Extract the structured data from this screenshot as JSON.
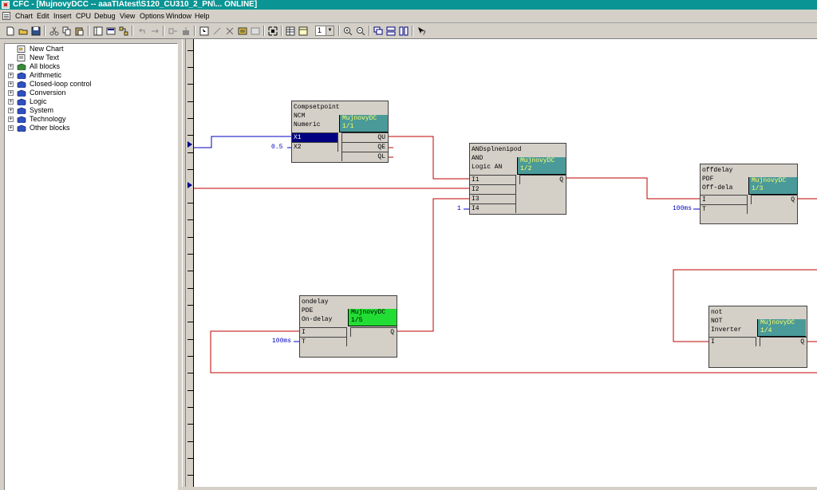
{
  "window": {
    "title": "CFC - [MujnovyDCC -- aaaTIAtest\\S120_CU310_2_PN\\... ONLINE]"
  },
  "menu": [
    "Chart",
    "Edit",
    "Insert",
    "CPU",
    "Debug",
    "View",
    "Options",
    "Window",
    "Help"
  ],
  "toolbar": {
    "zoom_value": "1",
    "buttons": [
      "new-icon",
      "open-icon",
      "save-icon",
      "cut-icon",
      "copy-icon",
      "paste-icon",
      "catalog-icon",
      "overview-icon",
      "run-sequence-icon",
      "undo-icon",
      "redo-icon",
      "compile-icon",
      "download-icon",
      "select-icon",
      "connect-icon",
      "delete-connection-icon",
      "interconnect-icon",
      "fit-view-icon",
      "sheet-view-icon",
      "overview-sheet-icon",
      "zoom-in-icon",
      "zoom-out-icon",
      "cascade-icon",
      "tile-horizontal-icon",
      "tile-vertical-icon",
      "context-help-icon"
    ]
  },
  "catalog": {
    "items": [
      {
        "label": "New Chart",
        "expandable": false
      },
      {
        "label": "New Text",
        "expandable": false
      },
      {
        "label": "All blocks",
        "expandable": true
      },
      {
        "label": "Arithmetic",
        "expandable": true
      },
      {
        "label": "Closed-loop control",
        "expandable": true
      },
      {
        "label": "Conversion",
        "expandable": true
      },
      {
        "label": "Logic",
        "expandable": true
      },
      {
        "label": "System",
        "expandable": true
      },
      {
        "label": "Technology",
        "expandable": true
      },
      {
        "label": "Other blocks",
        "expandable": true
      }
    ]
  },
  "blocks": {
    "compsetpoint": {
      "name": "Compsetpoint",
      "type": "NCM",
      "comment": "Numeric",
      "cpu_name": "MujnovyDC",
      "cpu_seq": "1/1",
      "inputs": [
        "X1",
        "X2"
      ],
      "outputs": [
        "QU",
        "QE",
        "QL"
      ],
      "x2_value": "0.5"
    },
    "andsplnenipod": {
      "name": "ANDsplnenipod",
      "type": "AND",
      "comment": "Logic AN",
      "cpu_name": "MujnovyDC",
      "cpu_seq": "1/2",
      "inputs": [
        "I1",
        "I2",
        "I3",
        "I4"
      ],
      "outputs": [
        "Q"
      ],
      "i4_value": "1"
    },
    "offdelay": {
      "name": "offdelay",
      "type": "PDF",
      "comment": "Off-dela",
      "cpu_name": "MujnovyDC",
      "cpu_seq": "1/3",
      "inputs": [
        "I",
        "T"
      ],
      "outputs": [
        "Q"
      ],
      "t_value": "100ms"
    },
    "ondelay": {
      "name": "ondelay",
      "type": "PDE",
      "comment": "On-delay",
      "cpu_name": "MujnovyDC",
      "cpu_seq": "1/5",
      "inputs": [
        "I",
        "T"
      ],
      "outputs": [
        "Q"
      ],
      "t_value": "100ms"
    },
    "not": {
      "name": "not",
      "type": "NOT",
      "comment": "Inverter",
      "cpu_name": "MujnovyDC",
      "cpu_seq": "1/4",
      "inputs": [
        "I"
      ],
      "outputs": [
        "Q"
      ]
    }
  },
  "colors": {
    "titlebar": "#0a9494",
    "cpu_box": "#4a9a9a",
    "cpu_box_active": "#22dd33",
    "cpu_text": "#ffff66",
    "wire_blue": "#0000c0",
    "wire_red": "#c00000",
    "selected_pin": "#000080",
    "param_value": "#0000c0"
  }
}
